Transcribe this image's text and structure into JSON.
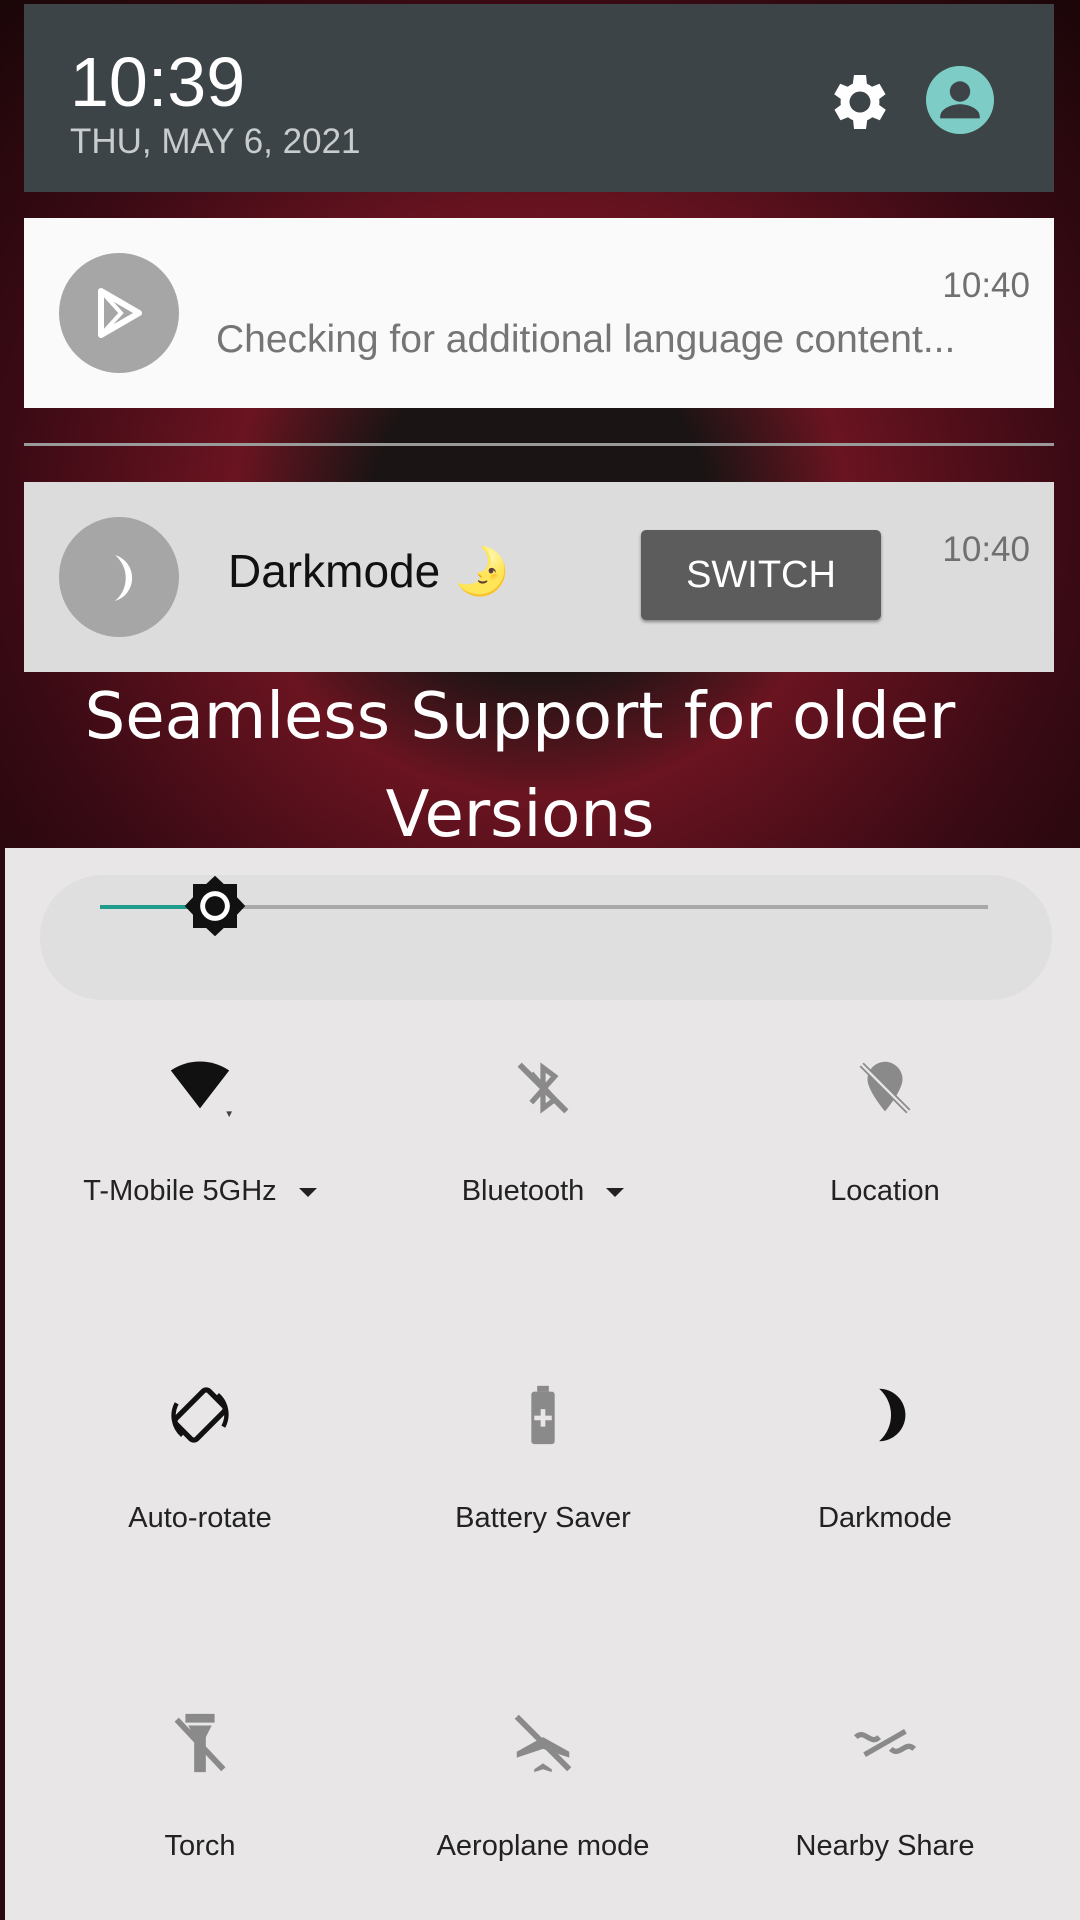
{
  "header": {
    "time": "10:39",
    "date": "THU, MAY 6, 2021",
    "icons": [
      "gear-icon",
      "account-icon"
    ],
    "avatar_color": "#7dcdc6"
  },
  "notifications": [
    {
      "app_icon": "play-store-icon",
      "time": "10:40",
      "text": "Checking for additional language content..."
    },
    {
      "app_icon": "moon-icon",
      "time": "10:40",
      "title": "Darkmode 🌛",
      "action": "SWITCH"
    }
  ],
  "caption": {
    "line1": "Seamless Support for older",
    "line2": "Versions"
  },
  "brightness": {
    "level": 0.13,
    "accent": "#1f9c8c"
  },
  "tiles": [
    {
      "label": "T-Mobile 5GHz",
      "icon": "wifi-icon",
      "dropdown": true,
      "active": true
    },
    {
      "label": "Bluetooth",
      "icon": "bluetooth-off-icon",
      "dropdown": true,
      "active": false
    },
    {
      "label": "Location",
      "icon": "location-off-icon",
      "active": false
    },
    {
      "label": "Auto-rotate",
      "icon": "auto-rotate-icon",
      "active": true
    },
    {
      "label": "Battery Saver",
      "icon": "battery-saver-icon",
      "active": false
    },
    {
      "label": "Darkmode",
      "icon": "moon-icon",
      "active": true
    },
    {
      "label": "Torch",
      "icon": "torch-off-icon",
      "active": false
    },
    {
      "label": "Aeroplane mode",
      "icon": "airplane-off-icon",
      "active": false
    },
    {
      "label": "Nearby Share",
      "icon": "nearby-share-icon",
      "active": false
    }
  ]
}
